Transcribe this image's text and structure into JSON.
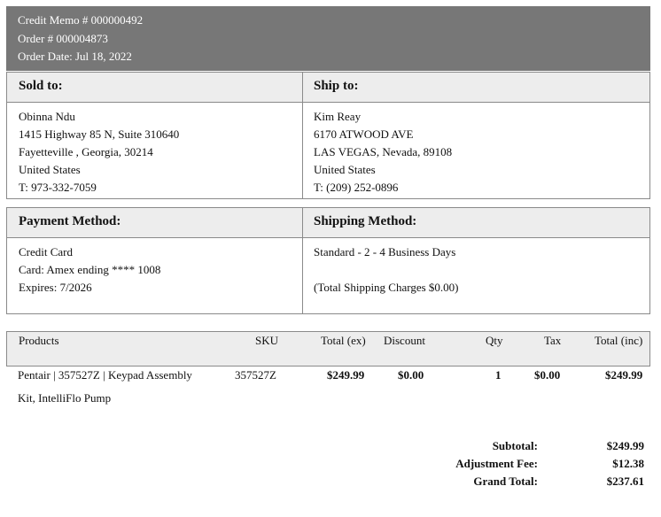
{
  "header": {
    "memo": "Credit Memo # 000000492",
    "order": "Order # 000004873",
    "date": "Order Date: Jul 18, 2022"
  },
  "sold_to": {
    "title": "Sold to:",
    "lines": [
      "Obinna Ndu",
      "1415 Highway 85 N, Suite 310640",
      "Fayetteville , Georgia, 30214",
      "United States",
      "T: 973-332-7059"
    ]
  },
  "ship_to": {
    "title": "Ship to:",
    "lines": [
      "Kim Reay",
      "6170 ATWOOD AVE",
      "LAS VEGAS, Nevada, 89108",
      "United States",
      "T: (209) 252-0896"
    ]
  },
  "payment": {
    "title": "Payment Method:",
    "lines": [
      "Credit Card",
      "Card: Amex ending **** 1008",
      "Expires: 7/2026"
    ]
  },
  "shipping": {
    "title": "Shipping Method:",
    "method": "Standard - 2 - 4 Business Days",
    "charges": "(Total Shipping Charges $0.00)"
  },
  "table": {
    "headers": {
      "products": "Products",
      "sku": "SKU",
      "total_ex": "Total (ex)",
      "discount": "Discount",
      "qty": "Qty",
      "tax": "Tax",
      "total_inc": "Total (inc)"
    },
    "row": {
      "name_line1": "Pentair | 357527Z | Keypad Assembly",
      "name_line2": "Kit, IntelliFlo Pump",
      "sku": "357527Z",
      "total_ex": "$249.99",
      "discount": "$0.00",
      "qty": "1",
      "tax": "$0.00",
      "total_inc": "$249.99"
    }
  },
  "totals": {
    "subtotal_label": "Subtotal:",
    "subtotal_value": "$249.99",
    "adjustment_label": "Adjustment Fee:",
    "adjustment_value": "$12.38",
    "grand_label": "Grand Total:",
    "grand_value": "$237.61"
  }
}
